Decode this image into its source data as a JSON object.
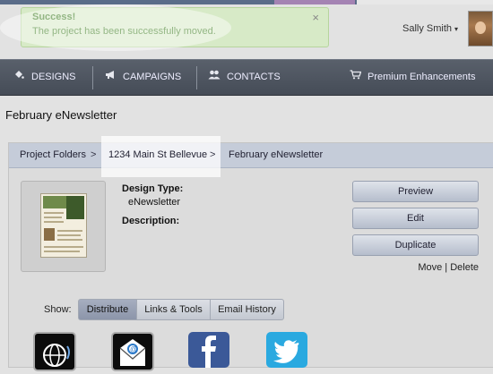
{
  "alert": {
    "title": "Success!",
    "message": "The project has been successfully moved.",
    "close": "×"
  },
  "user": {
    "name": "Sally Smith",
    "caret": "▾"
  },
  "nav": {
    "items": [
      {
        "label": "DESIGNS",
        "icon": "paint-bucket-icon"
      },
      {
        "label": "CAMPAIGNS",
        "icon": "megaphone-icon"
      },
      {
        "label": "CONTACTS",
        "icon": "people-icon"
      },
      {
        "label": "Premium Enhancements",
        "icon": "cart-icon"
      }
    ]
  },
  "page": {
    "title": "February eNewsletter"
  },
  "breadcrumb": {
    "items": [
      "Project Folders",
      "1234 Main St Bellevue",
      "February eNewsletter"
    ],
    "separator": ">"
  },
  "design": {
    "type_label": "Design Type:",
    "type_value": "eNewsletter",
    "description_label": "Description:"
  },
  "actions": {
    "preview": "Preview",
    "edit": "Edit",
    "duplicate": "Duplicate",
    "move": "Move",
    "divider": "|",
    "delete": "Delete"
  },
  "show": {
    "label": "Show:",
    "tabs": [
      "Distribute",
      "Links & Tools",
      "Email History"
    ],
    "active": "Distribute"
  },
  "share_icons": [
    "globe-icon",
    "email-icon",
    "facebook-icon",
    "twitter-icon"
  ]
}
